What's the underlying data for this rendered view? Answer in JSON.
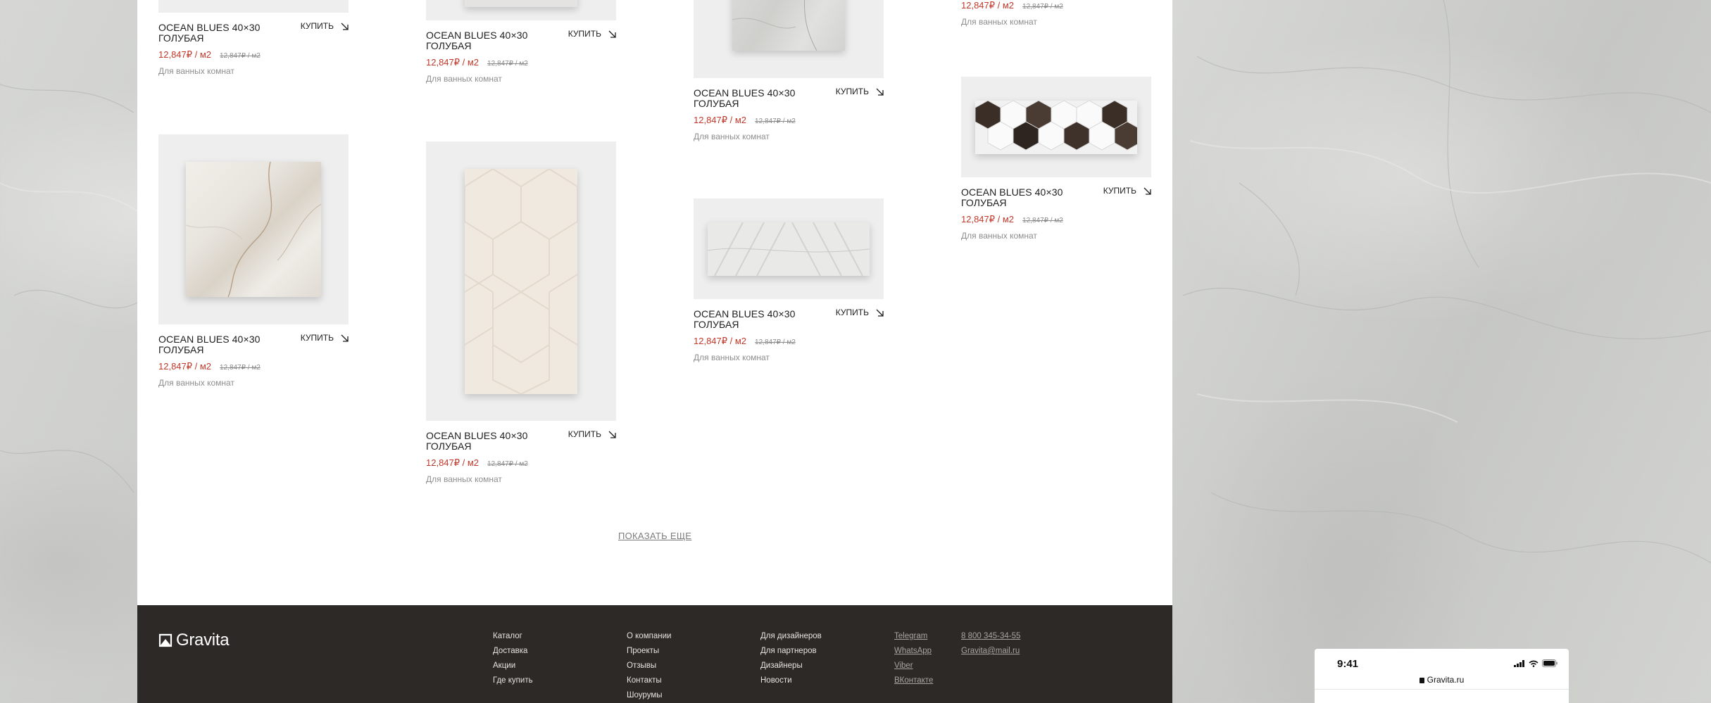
{
  "product": {
    "title": "OCEAN BLUES 40×30 ГОЛУБАЯ",
    "buy_label": "КУПИТЬ",
    "price": "12,847₽ / м2",
    "old_price": "12,847₽ / м2",
    "note": "Для ванных комнат"
  },
  "show_more": "ПОКАЗАТЬ ЕЩЕ",
  "footer": {
    "logo": "Gravita",
    "col1": [
      "Каталог",
      "Доставка",
      "Акции",
      "Где купить"
    ],
    "col2": [
      "О компании",
      "Проекты",
      "Отзывы",
      "Контакты",
      "Шоурумы"
    ],
    "col3": [
      "Для дизайнеров",
      "Для партнеров",
      "Дизайнеры",
      "Новости"
    ],
    "social": [
      "Telegram",
      "WhatsApp",
      "Viber",
      "ВКонтакте"
    ],
    "contacts": [
      "8 800 345-34-55",
      "Gravita@mail.ru"
    ]
  },
  "phone": {
    "time": "9:41",
    "url": "Gravita.ru"
  },
  "colors": {
    "price_red": "#c0392b",
    "footer_bg": "#2c2926",
    "card_bg": "#eeeeee"
  }
}
